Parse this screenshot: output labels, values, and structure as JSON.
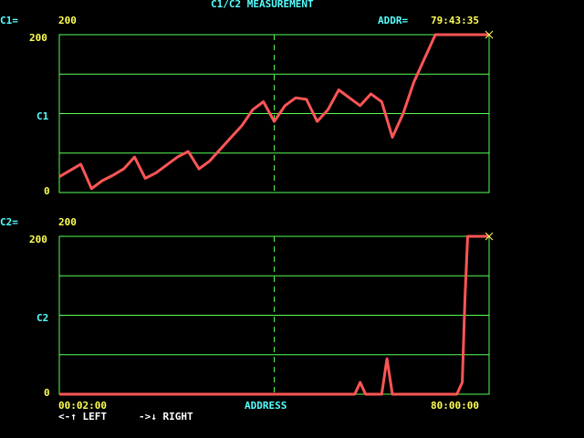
{
  "title": "C1/C2 MEASUREMENT",
  "header": {
    "c1_label": "C1=",
    "c1_value": "200",
    "addr_label": "ADDR=",
    "addr_value": "79:43:35"
  },
  "panel_c1": {
    "y_top": "200",
    "y_mid": "C1",
    "y_bottom": "0"
  },
  "panel_c2": {
    "value_label": "C2=",
    "value": "200",
    "y_top": "200",
    "y_mid": "C2",
    "y_bottom": "0"
  },
  "footer": {
    "x_start": "00:02:00",
    "x_center": "ADDRESS",
    "x_end": "80:00:00",
    "nav_left": "<-↑ LEFT",
    "nav_right": "->↓ RIGHT"
  },
  "colors": {
    "text_cyan": "#55ffff",
    "text_yellow": "#ffff55",
    "grid": "#55ff55",
    "trace": "#ff5555",
    "cursor_marker": "#ffff55",
    "background": "#000000"
  },
  "chart_data": [
    {
      "type": "line",
      "name": "C1",
      "x": [
        0,
        2,
        4,
        6,
        8,
        10,
        12,
        14,
        16,
        18,
        20,
        22,
        24,
        26,
        28,
        30,
        32,
        34,
        36,
        38,
        40,
        42,
        44,
        46,
        48,
        50,
        52,
        54,
        56,
        58,
        60,
        62,
        64,
        66,
        68,
        70,
        72,
        74,
        76,
        78,
        80
      ],
      "y": [
        20,
        28,
        36,
        5,
        15,
        22,
        30,
        45,
        18,
        25,
        35,
        45,
        52,
        30,
        40,
        55,
        70,
        85,
        105,
        115,
        90,
        110,
        120,
        118,
        90,
        105,
        130,
        120,
        110,
        125,
        115,
        70,
        100,
        140,
        170,
        200,
        200,
        200,
        200,
        200,
        200
      ],
      "x_range": [
        0,
        80
      ],
      "ylim": [
        0,
        200
      ],
      "grid": true
    },
    {
      "type": "line",
      "name": "C2",
      "x": [
        0,
        10,
        20,
        30,
        40,
        50,
        55,
        56,
        57,
        60,
        61,
        62,
        70,
        74,
        75,
        75.5,
        76,
        77,
        78,
        78.5,
        80
      ],
      "y": [
        0,
        0,
        0,
        0,
        0,
        0,
        0,
        15,
        0,
        0,
        45,
        0,
        0,
        0,
        15,
        120,
        200,
        200,
        200,
        200,
        200
      ],
      "x_range": [
        0,
        80
      ],
      "ylim": [
        0,
        200
      ],
      "grid": true
    }
  ]
}
